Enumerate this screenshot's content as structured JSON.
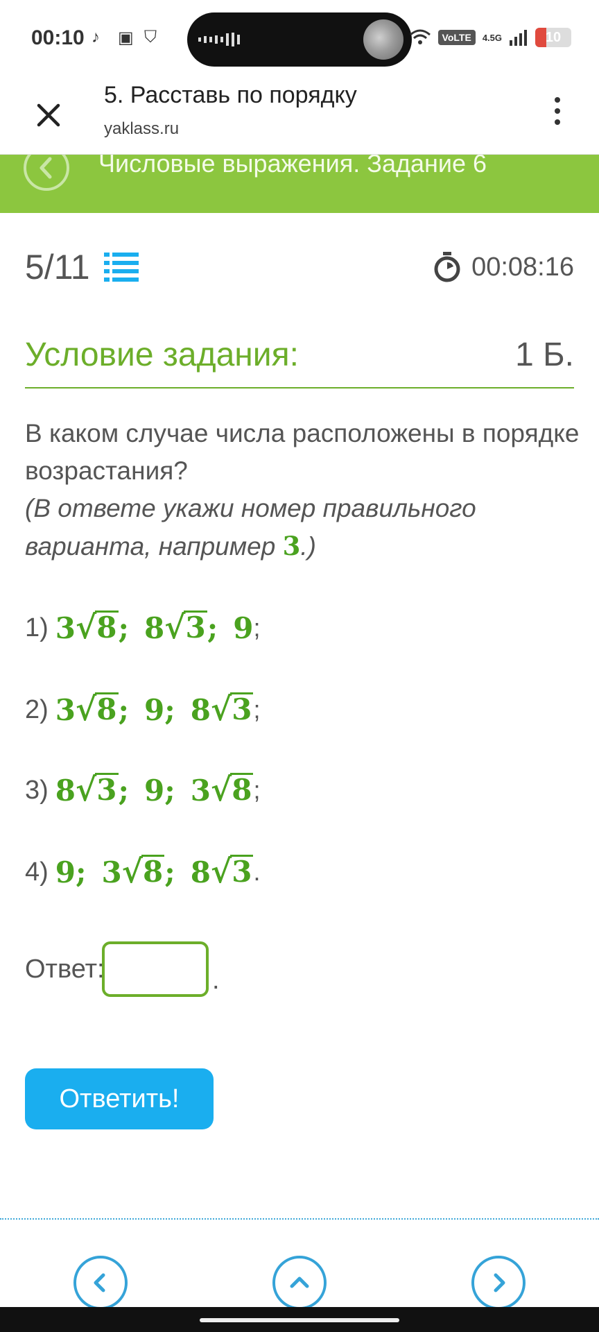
{
  "status_bar": {
    "time": "00:10",
    "network": "4.5G",
    "volte": "VoLTE",
    "battery": "10",
    "battery_level": 0.1
  },
  "browser": {
    "title": "5. Расставь по порядку",
    "url": "yaklass.ru"
  },
  "banner": {
    "title": "Числовые выражения. Задание 6"
  },
  "progress": {
    "text": "5/11"
  },
  "timer": {
    "value": "00:08:16"
  },
  "condition": {
    "label": "Условие задания:",
    "points": "1 Б."
  },
  "question": {
    "text": "В каком случае числа расположены в порядке возрастания?",
    "hint_prefix": "(В ответе укажи номер правильного варианта, например ",
    "hint_number": "3",
    "hint_suffix": ".)"
  },
  "options": [
    {
      "num": "1)",
      "items": [
        "3√8",
        "8√3",
        "9"
      ],
      "end": ";"
    },
    {
      "num": "2)",
      "items": [
        "3√8",
        "9",
        "8√3"
      ],
      "end": ";"
    },
    {
      "num": "3)",
      "items": [
        "8√3",
        "9",
        "3√8"
      ],
      "end": ";"
    },
    {
      "num": "4)",
      "items": [
        "9",
        "3√8",
        "8√3"
      ],
      "end": "."
    }
  ],
  "answer": {
    "label": "Ответ:",
    "value": "",
    "dot": "."
  },
  "submit": {
    "label": "Ответить!"
  },
  "icons": {
    "close": "close-icon",
    "menu": "kebab-menu-icon",
    "back": "chevron-left-icon",
    "list": "list-icon",
    "timer": "stopwatch-icon",
    "prev": "chevron-left-icon",
    "up": "chevron-up-icon",
    "next": "chevron-right-icon"
  },
  "colors": {
    "green": "#6cae2a",
    "banner": "#8cc63f",
    "button": "#1aaeef",
    "nav": "#35a3d8"
  }
}
